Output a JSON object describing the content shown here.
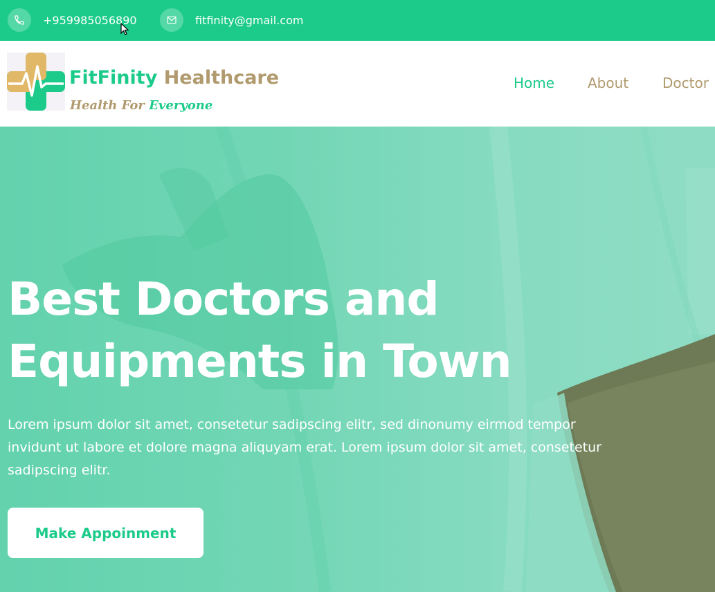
{
  "topbar": {
    "phone": "+959985056890",
    "phone_icon": "phone-icon",
    "email": "fitfinity@gmail.com",
    "email_icon": "mail-icon"
  },
  "brand": {
    "name_part1": "FitFinity ",
    "name_part2": "Healthcare",
    "tagline_part1": "Health For ",
    "tagline_part2": "Everyone",
    "logo_icon": "medical-cross-heartbeat-icon"
  },
  "nav": {
    "items": [
      {
        "label": "Home",
        "active": true
      },
      {
        "label": "About",
        "active": false
      },
      {
        "label": "Doctor",
        "active": false
      }
    ]
  },
  "hero": {
    "title_line1": "Best Doctors and",
    "title_line2": "Equipments in Town",
    "description": "Lorem ipsum dolor sit amet, consetetur sadipscing elitr, sed dinonumy eirmod tempor invidunt ut labore et dolore magna aliquyam erat. Lorem ipsum dolor sit amet, consetetur sadipscing elitr.",
    "cta_label": "Make Appoinment"
  },
  "colors": {
    "primary": "#1ccb8a",
    "secondary": "#b09a6e",
    "white": "#ffffff"
  }
}
